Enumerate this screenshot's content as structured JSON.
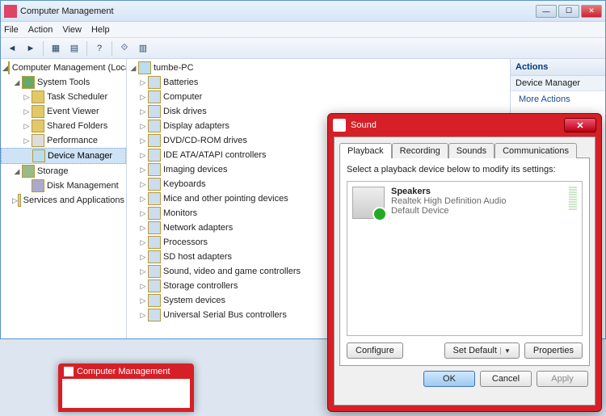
{
  "window": {
    "title": "Computer Management",
    "menus": [
      "File",
      "Action",
      "View",
      "Help"
    ]
  },
  "left_tree": {
    "root": "Computer Management (Local",
    "groups": [
      {
        "label": "System Tools",
        "items": [
          "Task Scheduler",
          "Event Viewer",
          "Shared Folders",
          "Performance",
          "Device Manager"
        ],
        "selected": "Device Manager"
      },
      {
        "label": "Storage",
        "items": [
          "Disk Management"
        ]
      },
      {
        "label": "Services and Applications",
        "items": []
      }
    ]
  },
  "device_tree": {
    "root": "tumbe-PC",
    "items": [
      "Batteries",
      "Computer",
      "Disk drives",
      "Display adapters",
      "DVD/CD-ROM drives",
      "IDE ATA/ATAPI controllers",
      "Imaging devices",
      "Keyboards",
      "Mice and other pointing devices",
      "Monitors",
      "Network adapters",
      "Processors",
      "SD host adapters",
      "Sound, video and game controllers",
      "Storage controllers",
      "System devices",
      "Universal Serial Bus controllers"
    ]
  },
  "actions": {
    "header": "Actions",
    "section": "Device Manager",
    "more": "More Actions"
  },
  "sound": {
    "title": "Sound",
    "tabs": [
      "Playback",
      "Recording",
      "Sounds",
      "Communications"
    ],
    "active_tab": 0,
    "instruction": "Select a playback device below to modify its settings:",
    "device": {
      "name": "Speakers",
      "desc": "Realtek High Definition Audio",
      "status": "Default Device"
    },
    "buttons": {
      "configure": "Configure",
      "set_default": "Set Default",
      "properties": "Properties",
      "ok": "OK",
      "cancel": "Cancel",
      "apply": "Apply"
    }
  },
  "thumb": {
    "title": "Computer Management"
  }
}
